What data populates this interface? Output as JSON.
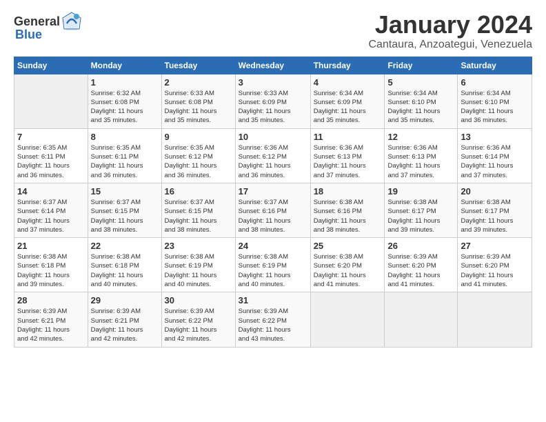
{
  "header": {
    "logo_general": "General",
    "logo_blue": "Blue",
    "title": "January 2024",
    "subtitle": "Cantaura, Anzoategui, Venezuela"
  },
  "columns": [
    "Sunday",
    "Monday",
    "Tuesday",
    "Wednesday",
    "Thursday",
    "Friday",
    "Saturday"
  ],
  "weeks": [
    [
      {
        "day": "",
        "info": ""
      },
      {
        "day": "1",
        "info": "Sunrise: 6:32 AM\nSunset: 6:08 PM\nDaylight: 11 hours\nand 35 minutes."
      },
      {
        "day": "2",
        "info": "Sunrise: 6:33 AM\nSunset: 6:08 PM\nDaylight: 11 hours\nand 35 minutes."
      },
      {
        "day": "3",
        "info": "Sunrise: 6:33 AM\nSunset: 6:09 PM\nDaylight: 11 hours\nand 35 minutes."
      },
      {
        "day": "4",
        "info": "Sunrise: 6:34 AM\nSunset: 6:09 PM\nDaylight: 11 hours\nand 35 minutes."
      },
      {
        "day": "5",
        "info": "Sunrise: 6:34 AM\nSunset: 6:10 PM\nDaylight: 11 hours\nand 35 minutes."
      },
      {
        "day": "6",
        "info": "Sunrise: 6:34 AM\nSunset: 6:10 PM\nDaylight: 11 hours\nand 36 minutes."
      }
    ],
    [
      {
        "day": "7",
        "info": "Sunrise: 6:35 AM\nSunset: 6:11 PM\nDaylight: 11 hours\nand 36 minutes."
      },
      {
        "day": "8",
        "info": "Sunrise: 6:35 AM\nSunset: 6:11 PM\nDaylight: 11 hours\nand 36 minutes."
      },
      {
        "day": "9",
        "info": "Sunrise: 6:35 AM\nSunset: 6:12 PM\nDaylight: 11 hours\nand 36 minutes."
      },
      {
        "day": "10",
        "info": "Sunrise: 6:36 AM\nSunset: 6:12 PM\nDaylight: 11 hours\nand 36 minutes."
      },
      {
        "day": "11",
        "info": "Sunrise: 6:36 AM\nSunset: 6:13 PM\nDaylight: 11 hours\nand 37 minutes."
      },
      {
        "day": "12",
        "info": "Sunrise: 6:36 AM\nSunset: 6:13 PM\nDaylight: 11 hours\nand 37 minutes."
      },
      {
        "day": "13",
        "info": "Sunrise: 6:36 AM\nSunset: 6:14 PM\nDaylight: 11 hours\nand 37 minutes."
      }
    ],
    [
      {
        "day": "14",
        "info": "Sunrise: 6:37 AM\nSunset: 6:14 PM\nDaylight: 11 hours\nand 37 minutes."
      },
      {
        "day": "15",
        "info": "Sunrise: 6:37 AM\nSunset: 6:15 PM\nDaylight: 11 hours\nand 38 minutes."
      },
      {
        "day": "16",
        "info": "Sunrise: 6:37 AM\nSunset: 6:15 PM\nDaylight: 11 hours\nand 38 minutes."
      },
      {
        "day": "17",
        "info": "Sunrise: 6:37 AM\nSunset: 6:16 PM\nDaylight: 11 hours\nand 38 minutes."
      },
      {
        "day": "18",
        "info": "Sunrise: 6:38 AM\nSunset: 6:16 PM\nDaylight: 11 hours\nand 38 minutes."
      },
      {
        "day": "19",
        "info": "Sunrise: 6:38 AM\nSunset: 6:17 PM\nDaylight: 11 hours\nand 39 minutes."
      },
      {
        "day": "20",
        "info": "Sunrise: 6:38 AM\nSunset: 6:17 PM\nDaylight: 11 hours\nand 39 minutes."
      }
    ],
    [
      {
        "day": "21",
        "info": "Sunrise: 6:38 AM\nSunset: 6:18 PM\nDaylight: 11 hours\nand 39 minutes."
      },
      {
        "day": "22",
        "info": "Sunrise: 6:38 AM\nSunset: 6:18 PM\nDaylight: 11 hours\nand 40 minutes."
      },
      {
        "day": "23",
        "info": "Sunrise: 6:38 AM\nSunset: 6:19 PM\nDaylight: 11 hours\nand 40 minutes."
      },
      {
        "day": "24",
        "info": "Sunrise: 6:38 AM\nSunset: 6:19 PM\nDaylight: 11 hours\nand 40 minutes."
      },
      {
        "day": "25",
        "info": "Sunrise: 6:38 AM\nSunset: 6:20 PM\nDaylight: 11 hours\nand 41 minutes."
      },
      {
        "day": "26",
        "info": "Sunrise: 6:39 AM\nSunset: 6:20 PM\nDaylight: 11 hours\nand 41 minutes."
      },
      {
        "day": "27",
        "info": "Sunrise: 6:39 AM\nSunset: 6:20 PM\nDaylight: 11 hours\nand 41 minutes."
      }
    ],
    [
      {
        "day": "28",
        "info": "Sunrise: 6:39 AM\nSunset: 6:21 PM\nDaylight: 11 hours\nand 42 minutes."
      },
      {
        "day": "29",
        "info": "Sunrise: 6:39 AM\nSunset: 6:21 PM\nDaylight: 11 hours\nand 42 minutes."
      },
      {
        "day": "30",
        "info": "Sunrise: 6:39 AM\nSunset: 6:22 PM\nDaylight: 11 hours\nand 42 minutes."
      },
      {
        "day": "31",
        "info": "Sunrise: 6:39 AM\nSunset: 6:22 PM\nDaylight: 11 hours\nand 43 minutes."
      },
      {
        "day": "",
        "info": ""
      },
      {
        "day": "",
        "info": ""
      },
      {
        "day": "",
        "info": ""
      }
    ]
  ]
}
